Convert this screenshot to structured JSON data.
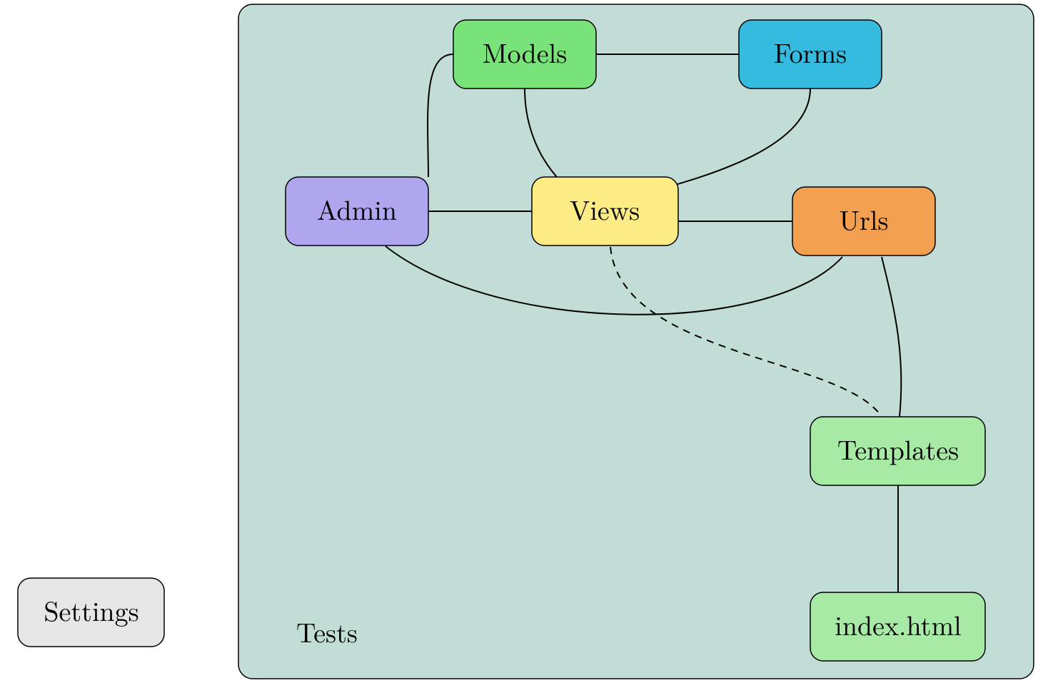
{
  "diagram": {
    "container": {
      "label": "Tests"
    },
    "nodes": {
      "models": {
        "label": "Models"
      },
      "forms": {
        "label": "Forms"
      },
      "admin": {
        "label": "Admin"
      },
      "views": {
        "label": "Views"
      },
      "urls": {
        "label": "Urls"
      },
      "templates": {
        "label": "Templates"
      },
      "index": {
        "label": "index.html"
      },
      "settings": {
        "label": "Settings"
      }
    }
  }
}
